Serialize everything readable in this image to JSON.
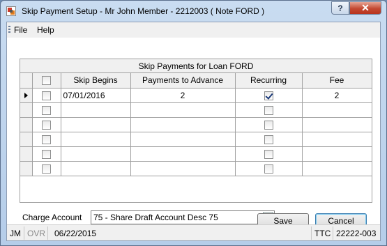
{
  "window": {
    "title": "Skip Payment Setup - Mr John Member - 2212003 ( Note  FORD )",
    "help_label": "?",
    "close_label": "✕"
  },
  "menu": {
    "items": [
      "File",
      "Help"
    ]
  },
  "grid": {
    "caption": "Skip Payments for Loan  FORD",
    "columns": [
      "Skip Begins",
      "Payments to Advance",
      "Recurring",
      "Fee"
    ],
    "rows": [
      {
        "selected": false,
        "skip_begins": "07/01/2016",
        "payments_to_advance": "2",
        "recurring": true,
        "fee": "2"
      },
      {
        "selected": false,
        "skip_begins": "",
        "payments_to_advance": "",
        "recurring": false,
        "fee": ""
      },
      {
        "selected": false,
        "skip_begins": "",
        "payments_to_advance": "",
        "recurring": false,
        "fee": ""
      },
      {
        "selected": false,
        "skip_begins": "",
        "payments_to_advance": "",
        "recurring": false,
        "fee": ""
      },
      {
        "selected": false,
        "skip_begins": "",
        "payments_to_advance": "",
        "recurring": false,
        "fee": ""
      },
      {
        "selected": false,
        "skip_begins": "",
        "payments_to_advance": "",
        "recurring": false,
        "fee": ""
      }
    ]
  },
  "charge_account": {
    "label": "Charge Account",
    "value": "75 - Share Draft Account Desc 75"
  },
  "buttons": {
    "save": "Save",
    "cancel": "Cancel"
  },
  "status": {
    "user": "JM",
    "override": "OVR",
    "date": "06/22/2015",
    "mode": "TTC",
    "terminal": "22222-003"
  }
}
